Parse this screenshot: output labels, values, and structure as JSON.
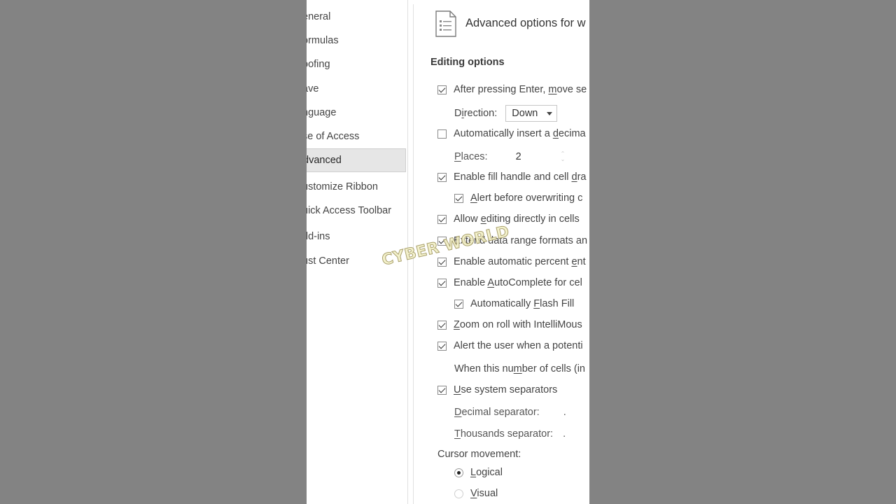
{
  "nav": {
    "items": [
      {
        "label": "eneral"
      },
      {
        "label": "ormulas"
      },
      {
        "label": "oofing"
      },
      {
        "label": "ave"
      },
      {
        "label": "nguage"
      },
      {
        "label": "se of Access"
      },
      {
        "label": "dvanced",
        "active": true
      },
      {
        "label": "ustomize Ribbon"
      },
      {
        "label": "uick Access Toolbar"
      },
      {
        "label": "dd-ins"
      },
      {
        "label": "ust Center"
      }
    ]
  },
  "header": {
    "title": "Advanced options for w"
  },
  "editing": {
    "section_title": "Editing options",
    "after_enter": {
      "pre": "After pressing Enter, ",
      "u": "m",
      "post": "ove se",
      "checked": true
    },
    "direction": {
      "pre": "D",
      "u": "i",
      "post": "rection:",
      "value": "Down"
    },
    "decimal": {
      "pre": "Automatically insert a ",
      "u": "d",
      "post": "ecima",
      "checked": false
    },
    "places": {
      "pre": "",
      "u": "P",
      "post": "laces:",
      "value": "2"
    },
    "fill_handle": {
      "pre": "Enable fill handle and cell ",
      "u": "d",
      "post": "ra",
      "checked": true
    },
    "alert_overwrite": {
      "pre": "",
      "u": "A",
      "post": "lert before overwriting c",
      "checked": true
    },
    "edit_directly": {
      "pre": "Allow ",
      "u": "e",
      "post": "diting directly in cells",
      "checked": true
    },
    "extend": {
      "label": "Extend data range formats an",
      "checked": true
    },
    "percent": {
      "pre": "Enable automatic percent ",
      "u": "e",
      "post": "nt",
      "checked": true
    },
    "autocomplete": {
      "pre": "Enable ",
      "u": "A",
      "post": "utoComplete for cel",
      "checked": true
    },
    "flash_fill": {
      "pre": "Automatically ",
      "u": "F",
      "post": "lash Fill",
      "checked": true
    },
    "zoom_roll": {
      "pre": "",
      "u": "Z",
      "post": "oom on roll with IntelliMous",
      "checked": true
    },
    "alert_user": {
      "label": "Alert the user when a potenti",
      "checked": true
    },
    "cells_count": {
      "pre": "When this nu",
      "u": "m",
      "post": "ber of cells (in"
    },
    "system_sep": {
      "pre": "",
      "u": "U",
      "post": "se system separators",
      "checked": true
    },
    "decimal_sep": {
      "pre": "",
      "u": "D",
      "post": "ecimal separator:",
      "value": "."
    },
    "thousands_sep": {
      "pre": "",
      "u": "T",
      "post": "housands separator:",
      "value": "."
    },
    "cursor_movement": "Cursor movement:",
    "logical": {
      "pre": "",
      "u": "L",
      "post": "ogical",
      "selected": true
    },
    "visual": {
      "pre": "",
      "u": "V",
      "post": "isual",
      "selected": false
    }
  },
  "watermark": "CYBER WORLD",
  "icons": {
    "page": "document-options-icon",
    "dropdown": "chevron-down-icon"
  }
}
